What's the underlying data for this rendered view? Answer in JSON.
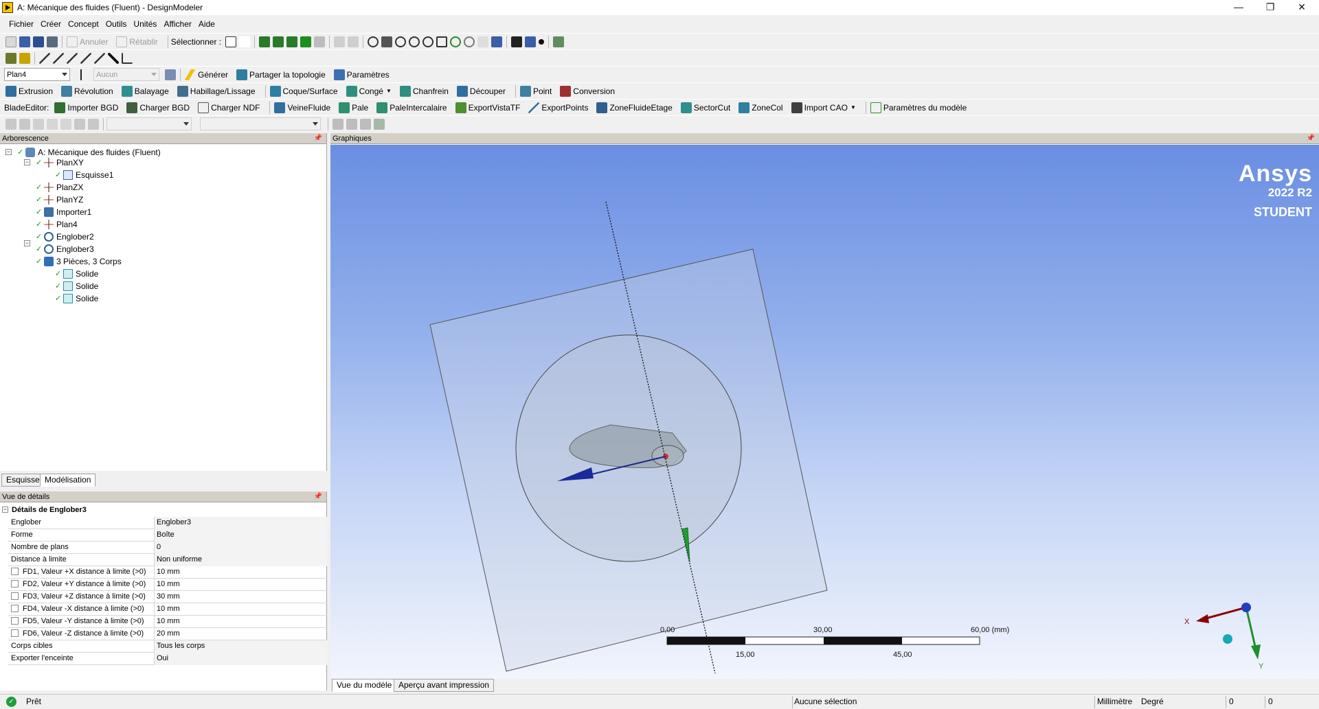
{
  "window": {
    "title": "A: Mécanique des fluides (Fluent) - DesignModeler",
    "minimize": "—",
    "maximize": "❐",
    "close": "✕"
  },
  "menu": [
    "Fichier",
    "Créer",
    "Concept",
    "Outils",
    "Unités",
    "Afficher",
    "Aide"
  ],
  "toolbar1": {
    "undo": "Annuler",
    "redo": "Rétablir",
    "select_label": "Sélectionner :"
  },
  "toolbar3": {
    "plane_combo": "Plan4",
    "sketch_combo": "Aucun",
    "generate": "Générer",
    "share_topology": "Partager la topologie",
    "parameters": "Paramètres"
  },
  "toolbar4": [
    "Extrusion",
    "Révolution",
    "Balayage",
    "Habillage/Lissage",
    "Coque/Surface",
    "Congé",
    "Chanfrein",
    "Découper",
    "Point",
    "Conversion"
  ],
  "toolbar5": {
    "label": "BladeEditor:",
    "items": [
      "Importer BGD",
      "Charger BGD",
      "Charger NDF",
      "VeineFluide",
      "Pale",
      "PaleIntercalaire",
      "ExportVistaTF",
      "ExportPoints",
      "ZoneFluideEtage",
      "SectorCut",
      "ZoneCol",
      "Import CAO",
      "Paramètres du modèle"
    ]
  },
  "tree": {
    "header": "Arborescence",
    "items": [
      {
        "label": "A: Mécanique des fluides (Fluent)",
        "icon": "project-icon"
      },
      {
        "label": "PlanXY",
        "icon": "plane-icon"
      },
      {
        "label": "Esquisse1",
        "icon": "sketch-icon"
      },
      {
        "label": "PlanZX",
        "icon": "plane-icon"
      },
      {
        "label": "PlanYZ",
        "icon": "plane-icon"
      },
      {
        "label": "Importer1",
        "icon": "import-icon"
      },
      {
        "label": "Plan4",
        "icon": "plane-icon"
      },
      {
        "label": "Englober2",
        "icon": "enclosure-icon"
      },
      {
        "label": "Englober3",
        "icon": "enclosure-icon"
      },
      {
        "label": "3 Pièces, 3 Corps",
        "icon": "parts-icon"
      },
      {
        "label": "Solide",
        "icon": "solid-icon"
      },
      {
        "label": "Solide",
        "icon": "solid-icon"
      },
      {
        "label": "Solide",
        "icon": "solid-icon"
      }
    ]
  },
  "left_tabs": [
    "Esquisse",
    "Modélisation"
  ],
  "details": {
    "header": "Vue de détails",
    "group": "Détails de Englober3",
    "rows": [
      {
        "key": "Englober",
        "value": "Englober3",
        "checkbox": false
      },
      {
        "key": "Forme",
        "value": "Boîte",
        "checkbox": false
      },
      {
        "key": "Nombre de plans",
        "value": "0",
        "checkbox": false
      },
      {
        "key": "Distance à limite",
        "value": "Non uniforme",
        "checkbox": false
      },
      {
        "key": "FD1,  Valeur +X distance à limite (>0)",
        "value": "10 mm",
        "checkbox": true
      },
      {
        "key": "FD2,  Valeur +Y distance à limite (>0)",
        "value": "10 mm",
        "checkbox": true
      },
      {
        "key": "FD3,  Valeur +Z distance à limite (>0)",
        "value": "30 mm",
        "checkbox": true
      },
      {
        "key": "FD4,  Valeur -X distance à limite (>0)",
        "value": "10 mm",
        "checkbox": true
      },
      {
        "key": "FD5,  Valeur -Y distance à limite (>0)",
        "value": "10 mm",
        "checkbox": true
      },
      {
        "key": "FD6,  Valeur -Z distance à limite (>0)",
        "value": "20 mm",
        "checkbox": true
      },
      {
        "key": "Corps cibles",
        "value": "Tous les corps",
        "checkbox": false
      },
      {
        "key": "Exporter l'enceinte",
        "value": "Oui",
        "checkbox": false
      }
    ]
  },
  "graphics": {
    "header": "Graphiques",
    "logo": {
      "brand": "Ansys",
      "version": "2022 R2",
      "edition": "STUDENT"
    },
    "scale": {
      "top_labels": [
        "0,00",
        "30,00",
        "60,00 (mm)"
      ],
      "bottom_labels": [
        "15,00",
        "45,00"
      ]
    },
    "triad": {
      "x": "X",
      "y": "Y"
    },
    "tabs": [
      "Vue du modèle",
      "Aperçu avant impression"
    ]
  },
  "status": {
    "ready": "Prêt",
    "selection": "Aucune sélection",
    "length_unit": "Millimètre",
    "angle_unit": "Degré",
    "val1": "0",
    "val2": "0"
  },
  "colors": {
    "graphics_top": "#6a8ee2",
    "graphics_bottom": "#f2f5fd",
    "check_green": "#1a9a1a",
    "x_axis": "#8b0000",
    "y_axis": "#1f8f2f"
  }
}
